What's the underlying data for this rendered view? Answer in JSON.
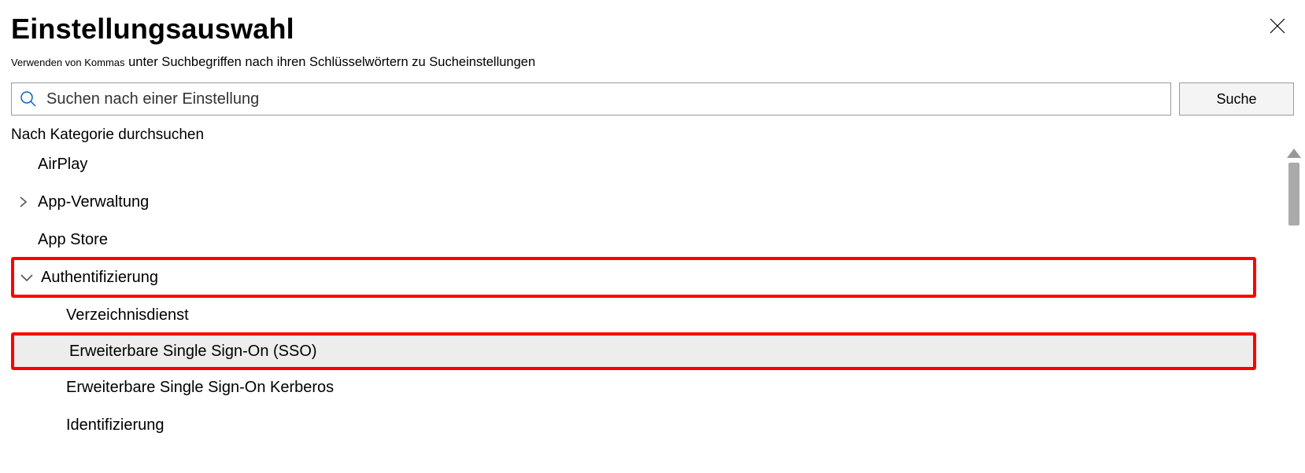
{
  "header": {
    "title": "Einstellungsauswahl",
    "subtitle_lead": "Verwenden von Kommas",
    "subtitle_rest": " unter Suchbegriffen nach ihren Schlüsselwörtern zu Sucheinstellungen"
  },
  "search": {
    "placeholder": "Suchen nach einer Einstellung",
    "button": "Suche"
  },
  "browse_label": "Nach Kategorie durchsuchen",
  "categories": {
    "airplay": "AirPlay",
    "app_mgmt": "App-Verwaltung",
    "app_store": "App Store",
    "auth": "Authentifizierung"
  },
  "auth_children": {
    "directory": "Verzeichnisdienst",
    "sso_ext": "Erweiterbare Single Sign-On (SSO)",
    "sso_kerb": "Erweiterbare Single Sign-On   Kerberos",
    "ident": "Identifizierung"
  }
}
